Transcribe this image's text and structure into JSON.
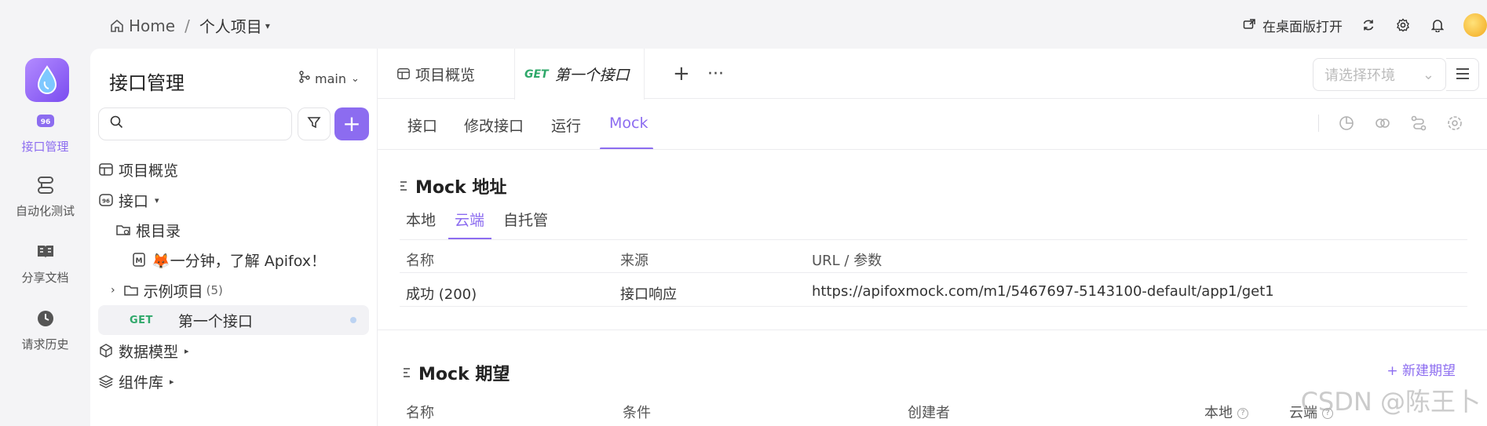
{
  "topbar": {
    "breadcrumb_home": "Home",
    "breadcrumb_sep": "/",
    "breadcrumb_project": "个人项目",
    "open_desktop": "在桌面版打开"
  },
  "rail": {
    "items": [
      {
        "label": "接口管理",
        "icon": "api-icon",
        "active": true
      },
      {
        "label": "自动化测试",
        "icon": "automation-icon",
        "active": false
      },
      {
        "label": "分享文档",
        "icon": "book-icon",
        "active": false
      },
      {
        "label": "请求历史",
        "icon": "clock-icon",
        "active": false
      }
    ]
  },
  "sidebar": {
    "title": "接口管理",
    "branch": "main",
    "search_placeholder": "",
    "tree": {
      "overview": "项目概览",
      "api": "接口",
      "root": "根目录",
      "intro": "🦊一分钟，了解 Apifox！",
      "examples": "示例项目",
      "examples_count": "(5)",
      "first_api_method": "GET",
      "first_api": "第一个接口",
      "data_model": "数据模型",
      "components": "组件库"
    }
  },
  "main": {
    "tabs": {
      "overview": "项目概览",
      "active_method": "GET",
      "active_title": "第一个接口"
    },
    "env_placeholder": "请选择环境",
    "subtabs": [
      "接口",
      "修改接口",
      "运行",
      "Mock"
    ],
    "mock_address": {
      "title": "Mock 地址",
      "tabs": [
        "本地",
        "云端",
        "自托管"
      ],
      "columns": [
        "名称",
        "来源",
        "URL / 参数"
      ],
      "row": {
        "name": "成功 (200)",
        "source": "接口响应",
        "url": "https://apifoxmock.com/m1/5467697-5143100-default/app1/get1"
      }
    },
    "mock_expect": {
      "title": "Mock 期望",
      "new_button": "+ 新建期望",
      "columns": [
        "名称",
        "条件",
        "创建者",
        "本地",
        "云端"
      ]
    }
  },
  "watermark": "CSDN @陈王卜",
  "colors": {
    "accent": "#8c6cf0",
    "get_green": "#2fa86a"
  }
}
